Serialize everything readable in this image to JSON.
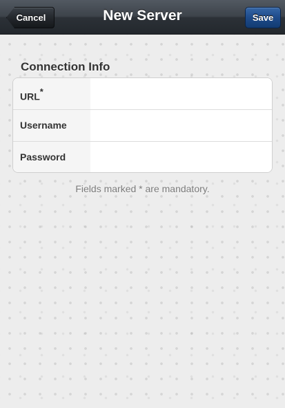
{
  "header": {
    "title": "New Server",
    "cancel_label": "Cancel",
    "save_label": "Save"
  },
  "section": {
    "title": "Connection Info"
  },
  "fields": [
    {
      "label": "URL",
      "required_mark": "*",
      "value": ""
    },
    {
      "label": "Username",
      "value": ""
    },
    {
      "label": "Password",
      "value": ""
    }
  ],
  "footnote": "Fields marked * are mandatory.",
  "colors": {
    "navbar": "#2c3137",
    "save_button": "#1e4b8a",
    "background": "#ededed"
  }
}
